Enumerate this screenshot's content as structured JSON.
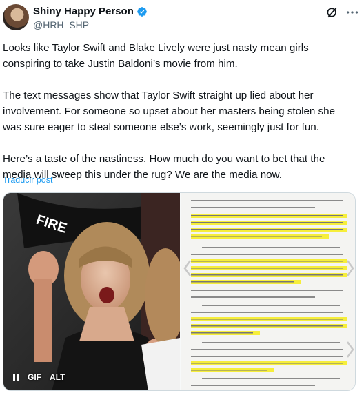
{
  "author": {
    "display_name": "Shiny Happy Person",
    "handle": "@HRH_SHP",
    "verified": true,
    "accent": "#1d9bf0"
  },
  "tweet": {
    "paragraphs": [
      "Looks like Taylor Swift and Blake Lively were just nasty mean girls conspiring to take Justin Baldoni’s movie from him.",
      "The text messages show that Taylor Swift straight up lied about her involvement. For someone so upset about her masters being stolen she was sure eager to steal someone else’s work, seemingly just for fun.",
      "Here’s a taste of the nastiness. How much do you want to bet that the media will sweep this under the rug? We are the media now."
    ],
    "translate_label": "Traducir post"
  },
  "media": {
    "left_badges": {
      "gif": "GIF",
      "alt": "ALT"
    },
    "left_overlay_text": "FIRE",
    "icons": [
      "grok-icon",
      "more-icon",
      "verified-icon",
      "pause-icon",
      "chevron-left-icon",
      "chevron-right-icon"
    ]
  }
}
